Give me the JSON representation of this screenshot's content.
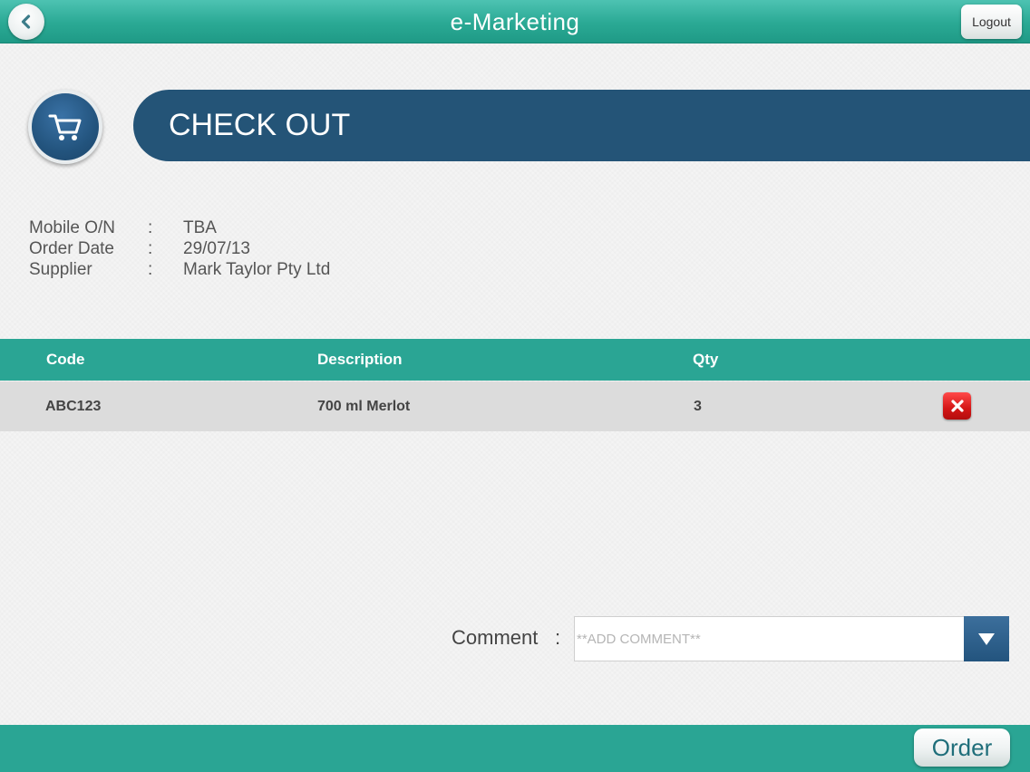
{
  "app": {
    "title": "e-Marketing",
    "logout_label": "Logout",
    "back_icon": "chevron-left-icon"
  },
  "header": {
    "title": "CHECK OUT",
    "icon": "cart-icon"
  },
  "order_info": [
    {
      "label": "Mobile O/N",
      "separator": ":",
      "value": "TBA"
    },
    {
      "label": "Order Date",
      "separator": ":",
      "value": "29/07/13"
    },
    {
      "label": "Supplier",
      "separator": ":",
      "value": "Mark Taylor Pty Ltd"
    }
  ],
  "table": {
    "columns": [
      "Code",
      "Description",
      "Qty"
    ],
    "rows": [
      {
        "code": "ABC123",
        "description": "700 ml Merlot",
        "qty": "3",
        "delete_icon": "close-icon"
      }
    ]
  },
  "comment": {
    "label": "Comment",
    "separator": ":",
    "placeholder": "**ADD COMMENT**",
    "value": "",
    "dropdown_icon": "triangle-down-icon"
  },
  "footer": {
    "order_label": "Order"
  },
  "colors": {
    "teal": "#2aa594",
    "navy": "#245477",
    "row_bg": "#dcdcdc",
    "delete_red": "#d41616"
  }
}
